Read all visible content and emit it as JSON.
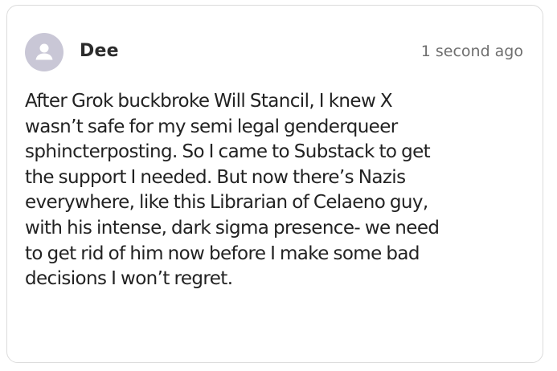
{
  "comment": {
    "author": "Dee",
    "timestamp": "1 second ago",
    "avatar_icon": "user-silhouette-icon",
    "body_lines": [
      "After Grok buckbroke Will Stancil, I knew X",
      "wasn’t safe for my semi legal genderqueer",
      "sphincterposting. So I came to Substack to get",
      "the support I needed. But now there’s Nazis",
      "everywhere, like this Librarian of Celaeno guy,",
      "with his intense, dark sigma presence- we need",
      "to get rid of him now before I make some bad",
      "decisions I won’t regret."
    ]
  },
  "colors": {
    "avatar_bg": "#c9c7d6",
    "avatar_fg": "#ffffff",
    "border": "#dcdcdc",
    "text": "#222222",
    "muted": "#6f6f6f"
  }
}
